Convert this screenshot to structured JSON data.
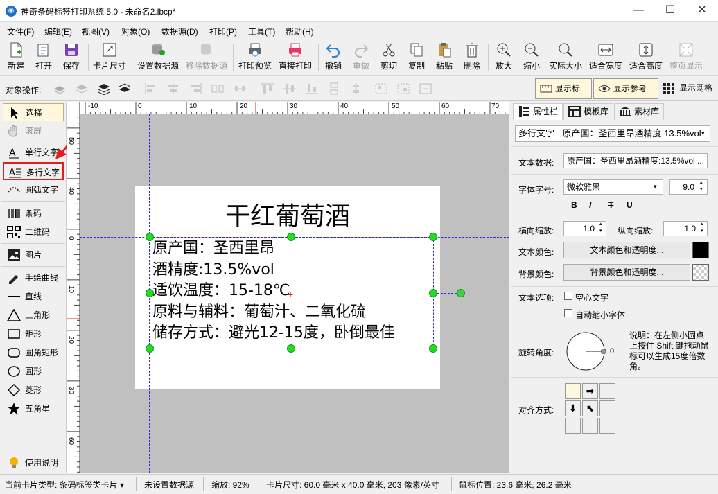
{
  "window": {
    "title": "神奇条码标签打印系统 5.0 - 未命名2.lbcp*",
    "min": "—",
    "max": "☐",
    "close": "✕"
  },
  "menu": [
    "文件(F)",
    "编辑(E)",
    "视图(V)",
    "对象(O)",
    "数据源(D)",
    "打印(P)",
    "工具(T)",
    "帮助(H)"
  ],
  "toolbar": {
    "new": "新建",
    "open": "打开",
    "save": "保存",
    "card_size": "卡片尺寸",
    "set_datasource": "设置数据源",
    "remove_datasource": "移除数据源",
    "print_preview": "打印预览",
    "direct_print": "直接打印",
    "undo": "撤销",
    "redo": "重做",
    "cut": "剪切",
    "copy": "复制",
    "paste": "粘贴",
    "delete": "删除",
    "zoom_in": "放大",
    "zoom_out": "缩小",
    "actual_size": "实际大小",
    "fit_width": "适合宽度",
    "fit_height": "适合高度",
    "fit_page": "整页显示"
  },
  "objbar": {
    "label": "对象操作:",
    "show_ruler": "显示标尺",
    "show_guides": "显示参考线",
    "show_grid": "显示网格"
  },
  "tools": {
    "select": "选择",
    "scroll": "滚屏",
    "single_text": "单行文字",
    "multi_text": "多行文字",
    "arc_text": "圆弧文字",
    "barcode": "条码",
    "qrcode": "二维码",
    "image": "图片",
    "freehand": "手绘曲线",
    "line": "直线",
    "triangle": "三角形",
    "rect": "矩形",
    "round_rect": "圆角矩形",
    "circle": "圆形",
    "diamond": "菱形",
    "star": "五角星",
    "help": "使用说明"
  },
  "ruler": {
    "h_ticks": [
      "-10",
      "0",
      "10",
      "20",
      "30",
      "40",
      "50",
      "60",
      "70"
    ],
    "v_ticks": [
      "0",
      "10",
      "20",
      "30",
      "40",
      "50",
      "60"
    ]
  },
  "label": {
    "title": "干红葡萄酒",
    "lines": [
      "原产国：圣西里昂",
      "酒精度:13.5%vol",
      "适饮温度：15-18℃",
      "原料与辅料：葡萄汁、二氧化硫",
      "储存方式：避光12-15度，卧倒最佳"
    ]
  },
  "panel": {
    "tabs": [
      "属性栏",
      "模板库",
      "素材库"
    ],
    "object_select": "多行文字 - 原产国：圣西里昂酒精度:13.5%vol",
    "text_data_label": "文本数据:",
    "text_data_value": "原产国：圣西里昂酒精度:13.5%vol ...",
    "font_label": "字体字号:",
    "font_name": "微软雅黑",
    "font_size": "9.0",
    "bold": "B",
    "italic": "I",
    "strike": "T",
    "underline": "U",
    "hscale_label": "横向缩放:",
    "hscale": "1.0",
    "vscale_label": "纵向缩放:",
    "vscale": "1.0",
    "text_color_label": "文本颜色:",
    "text_color_button": "文本颜色和透明度...",
    "bg_color_label": "背景颜色:",
    "bg_color_button": "背景颜色和透明度...",
    "text_options_label": "文本选项:",
    "hollow_text": "空心文字",
    "auto_shrink": "自动缩小字体",
    "rotation_label": "旋转角度:",
    "rotation_value": "0",
    "rotation_note": "说明：在左侧小圆点上按住 Shift 键拖动鼠标可以生成15度倍数角。",
    "align_label": "对齐方式:",
    "text_color": "#000000"
  },
  "status": {
    "card_type": "当前卡片类型: 条码标签类卡片 ▾",
    "datasource": "未设置数据源",
    "zoom": "缩放: 92%",
    "card_size": "卡片尺寸: 60.0 毫米 x 40.0 毫米, 203 像素/英寸",
    "mouse_pos": "鼠标位置: 23.6 毫米, 26.2 毫米"
  }
}
